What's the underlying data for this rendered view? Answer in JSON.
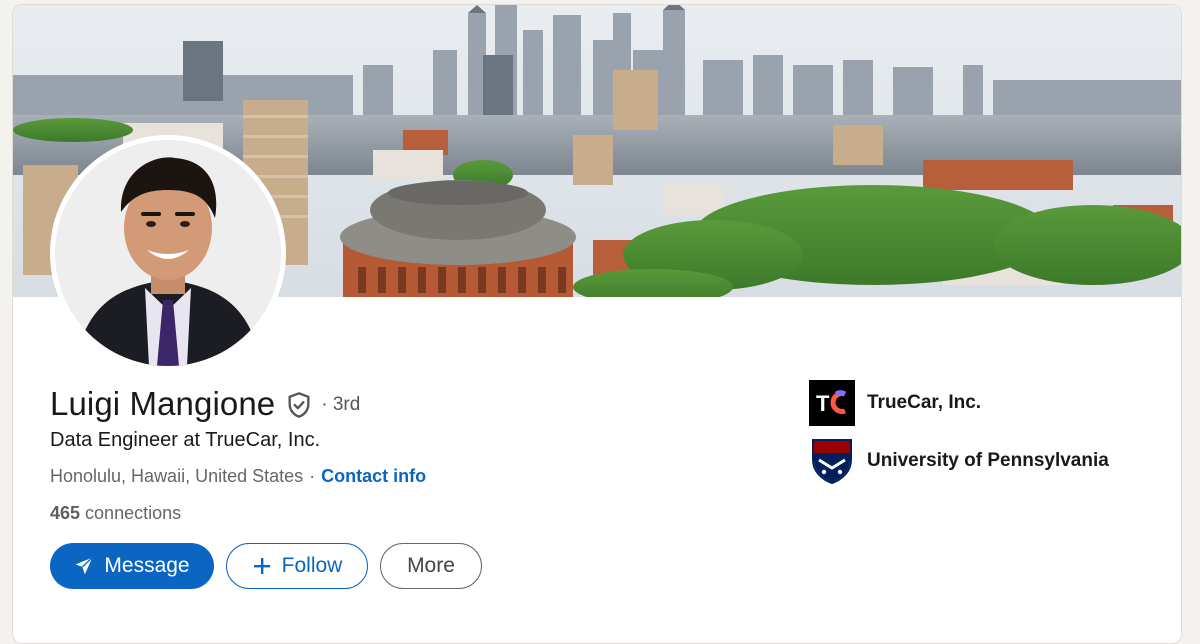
{
  "profile": {
    "name": "Luigi Mangione",
    "degree": "· 3rd",
    "headline": "Data Engineer at TrueCar, Inc.",
    "location": "Honolulu, Hawaii, United States",
    "location_sep": "·",
    "contact_info": "Contact info",
    "connections_count": "465",
    "connections_label": " connections"
  },
  "actions": {
    "message": "Message",
    "follow": "Follow",
    "more": "More"
  },
  "orgs": [
    {
      "name": "TrueCar, Inc.",
      "logo_text": "TC",
      "icon": "truecar-logo"
    },
    {
      "name": "University of Pennsylvania",
      "icon": "upenn-shield-logo"
    }
  ],
  "colors": {
    "linkedin_blue": "#0a66c2",
    "penn_red": "#990000",
    "penn_blue": "#011f5b"
  }
}
